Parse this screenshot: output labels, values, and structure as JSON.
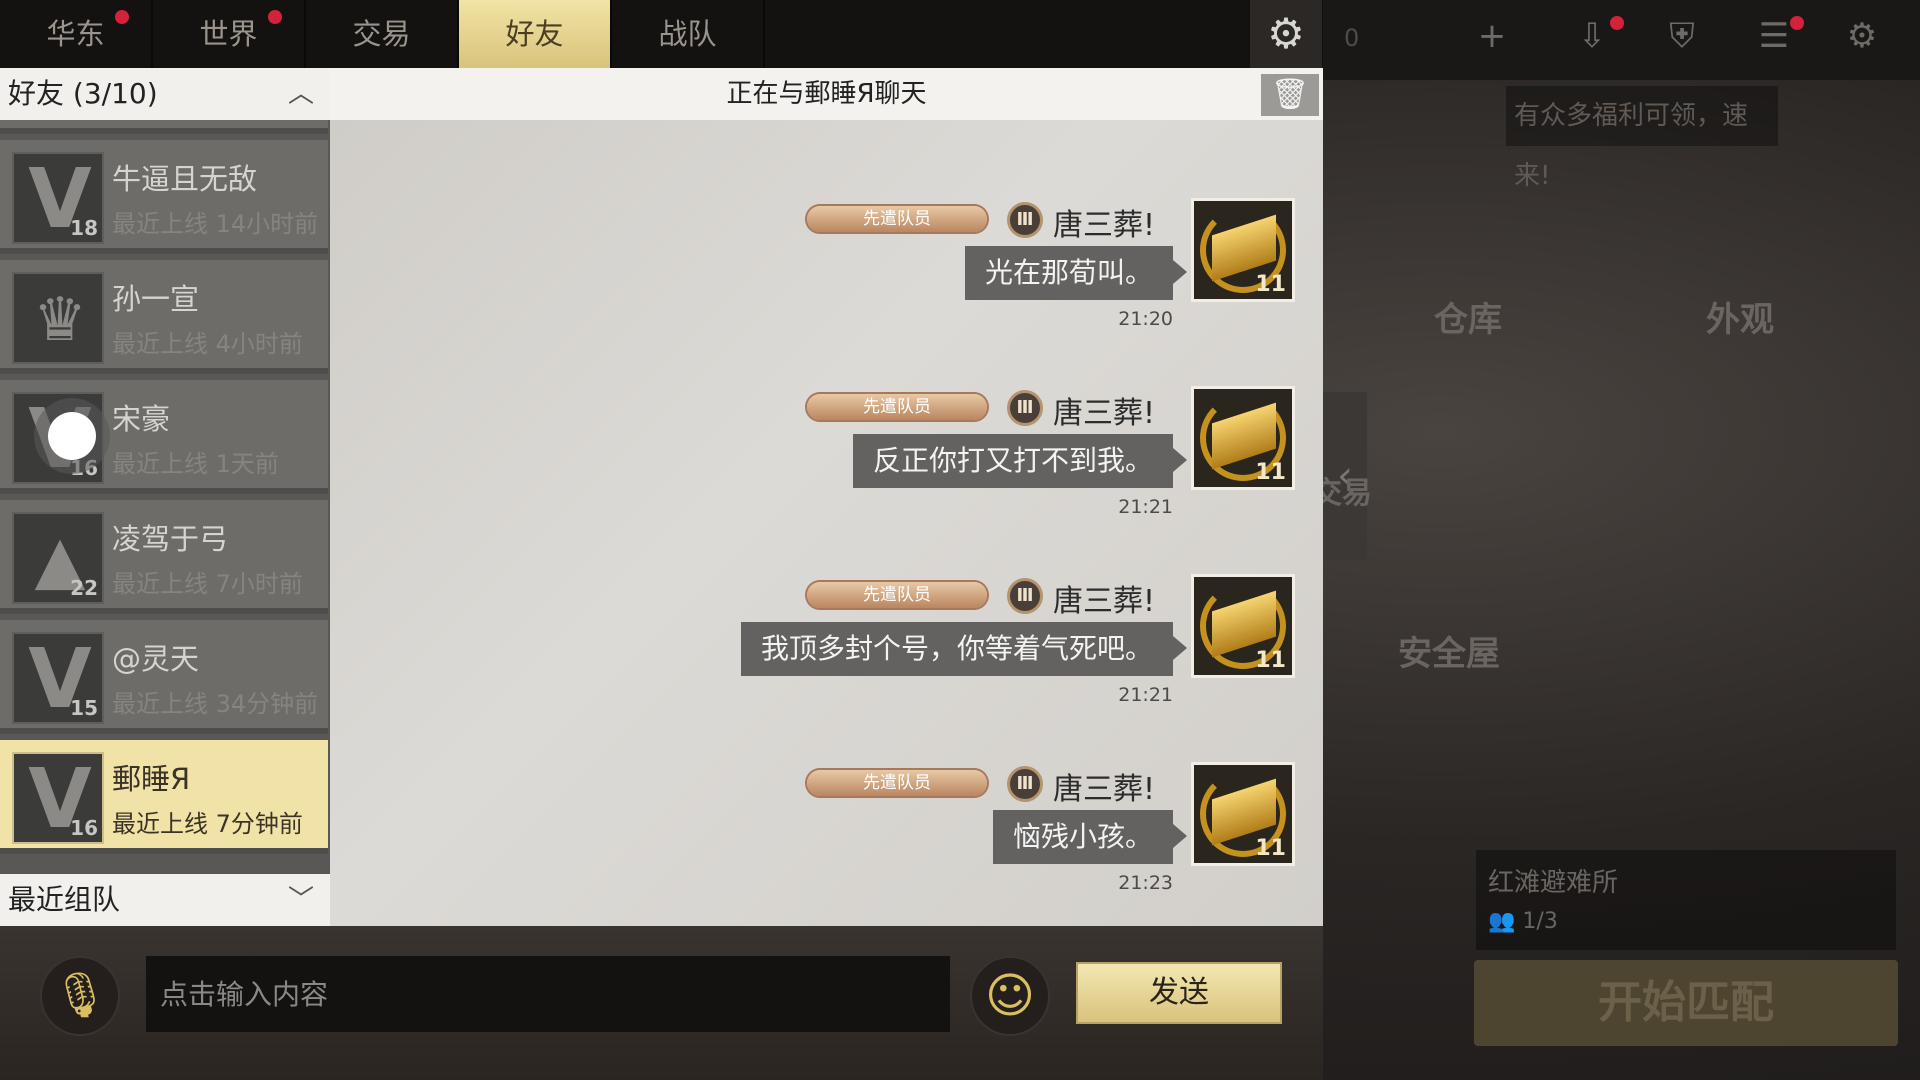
{
  "tabs": [
    {
      "label": "华东",
      "dot": true
    },
    {
      "label": "世界",
      "dot": true
    },
    {
      "label": "交易",
      "dot": false
    },
    {
      "label": "好友",
      "dot": false,
      "active": true
    },
    {
      "label": "战队",
      "dot": false
    }
  ],
  "background": {
    "count": "0",
    "promo": "有众多福利可领，速来!",
    "warehouse": "仓库",
    "appearance": "外观",
    "trade_hint": "交易",
    "safehouse": "安全屋",
    "shelter_name": "红滩避难所",
    "shelter_players": "1/3",
    "match_button": "开始匹配"
  },
  "friends": {
    "header": "好友 (3/10)",
    "items": [
      {
        "name": "牛逼且无敌",
        "last_seen": "最近上线 14小时前",
        "level": "18"
      },
      {
        "name": "孙一宣",
        "last_seen": "最近上线 4小时前",
        "level": ""
      },
      {
        "name": "宋豪",
        "last_seen": "最近上线 1天前",
        "level": "16"
      },
      {
        "name": "凌驾于弓",
        "last_seen": "最近上线 7小时前",
        "level": "22"
      },
      {
        "name": "@灵天",
        "last_seen": "最近上线 34分钟前",
        "level": "15"
      },
      {
        "name": "郵睡Я",
        "last_seen": "最近上线 7分钟前",
        "level": "16",
        "selected": true
      }
    ],
    "recent_header": "最近组队"
  },
  "chat": {
    "title": "正在与郵睡Я聊天",
    "messages": [
      {
        "rank": "先遣队员",
        "tier": "Ⅲ",
        "sender": "唐三葬!",
        "text": "光在那荀叫。",
        "time": "21:20",
        "avatar_level": "11"
      },
      {
        "rank": "先遣队员",
        "tier": "Ⅲ",
        "sender": "唐三葬!",
        "text": "反正你打又打不到我。",
        "time": "21:21",
        "avatar_level": "11"
      },
      {
        "rank": "先遣队员",
        "tier": "Ⅲ",
        "sender": "唐三葬!",
        "text": "我顶多封个号，你等着气死吧。",
        "time": "21:21",
        "avatar_level": "11"
      },
      {
        "rank": "先遣队员",
        "tier": "Ⅲ",
        "sender": "唐三葬!",
        "text": "恼残小孩。",
        "time": "21:23",
        "avatar_level": "11"
      }
    ]
  },
  "input": {
    "placeholder": "点击输入内容",
    "send_label": "发送"
  }
}
